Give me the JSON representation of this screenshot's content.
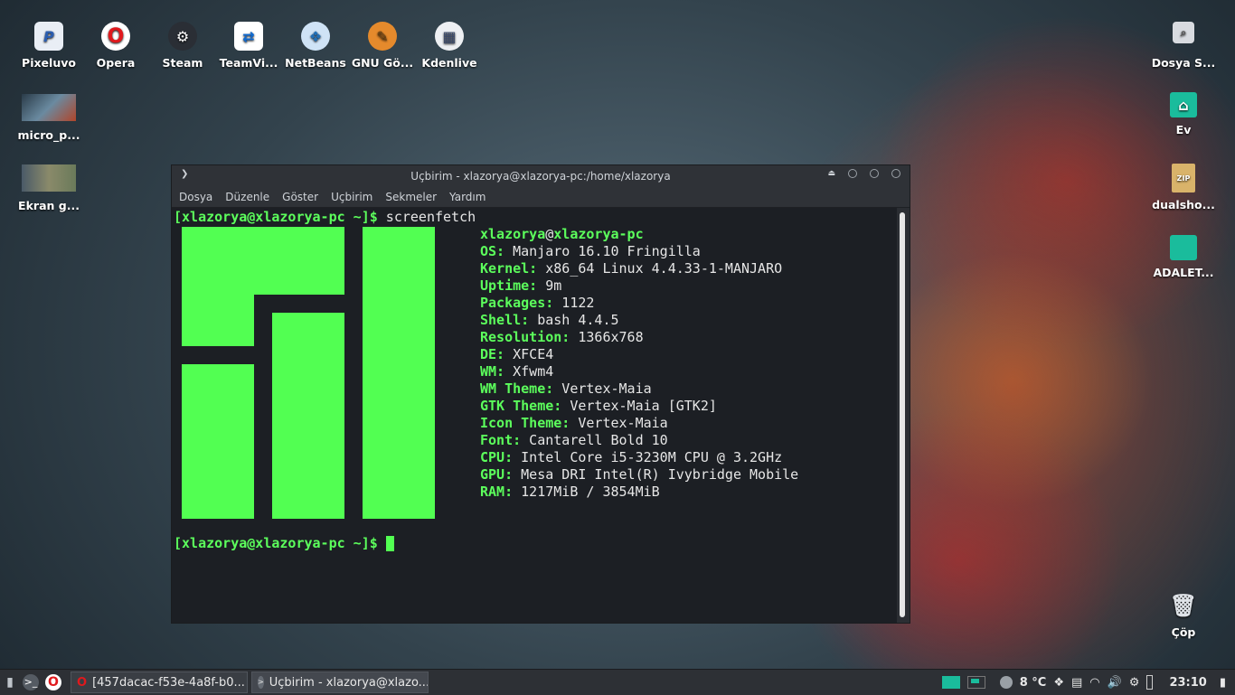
{
  "desktop_left": [
    {
      "label": "Pixeluvo",
      "icon": "pixeluvo-icon"
    },
    {
      "label": "Opera",
      "icon": "opera-icon"
    },
    {
      "label": "Steam",
      "icon": "steam-icon"
    },
    {
      "label": "TeamVi...",
      "icon": "teamviewer-icon"
    },
    {
      "label": "NetBeans",
      "icon": "netbeans-icon"
    },
    {
      "label": "GNU Gö...",
      "icon": "gimp-icon"
    },
    {
      "label": "Kdenlive",
      "icon": "kdenlive-icon"
    },
    {
      "label": "micro_p...",
      "icon": "image-thumbnail-icon"
    },
    {
      "label": "Ekran g...",
      "icon": "screenshot-thumbnail-icon"
    }
  ],
  "desktop_right": [
    {
      "label": "Dosya S...",
      "icon": "file-system-icon"
    },
    {
      "label": "Ev",
      "icon": "home-folder-icon"
    },
    {
      "label": "dualsho...",
      "icon": "zip-archive-icon"
    },
    {
      "label": "ADALET...",
      "icon": "folder-icon"
    },
    {
      "label": "Çöp",
      "icon": "trash-icon"
    }
  ],
  "window": {
    "title": "Uçbirim - xlazorya@xlazorya-pc:/home/xlazorya",
    "menu": [
      "Dosya",
      "Düzenle",
      "Göster",
      "Uçbirim",
      "Sekmeler",
      "Yardım"
    ]
  },
  "terminal": {
    "prompt": "[xlazorya@xlazorya-pc ~]$",
    "command": " screenfetch",
    "user": "xlazorya",
    "at": "@",
    "host": "xlazorya-pc",
    "info": [
      {
        "key": "OS:",
        "value": " Manjaro 16.10 Fringilla"
      },
      {
        "key": "Kernel:",
        "value": " x86_64 Linux 4.4.33-1-MANJARO"
      },
      {
        "key": "Uptime:",
        "value": " 9m"
      },
      {
        "key": "Packages:",
        "value": " 1122"
      },
      {
        "key": "Shell:",
        "value": " bash 4.4.5"
      },
      {
        "key": "Resolution:",
        "value": " 1366x768"
      },
      {
        "key": "DE:",
        "value": " XFCE4"
      },
      {
        "key": "WM:",
        "value": " Xfwm4"
      },
      {
        "key": "WM Theme:",
        "value": " Vertex-Maia"
      },
      {
        "key": "GTK Theme:",
        "value": " Vertex-Maia [GTK2]"
      },
      {
        "key": "Icon Theme:",
        "value": " Vertex-Maia"
      },
      {
        "key": "Font:",
        "value": " Cantarell Bold 10"
      },
      {
        "key": "CPU:",
        "value": " Intel Core i5-3230M CPU @ 3.2GHz"
      },
      {
        "key": "GPU:",
        "value": " Mesa DRI Intel(R) Ivybridge Mobile"
      },
      {
        "key": "RAM:",
        "value": " 1217MiB / 3854MiB"
      }
    ],
    "prompt2": "[xlazorya@xlazorya-pc ~]$"
  },
  "taskbar": {
    "tasks": [
      {
        "label": "[457dacac-f53e-4a8f-b0...",
        "icon": "opera-icon"
      },
      {
        "label": "Uçbirim - xlazorya@xlazo...",
        "icon": "terminal-icon"
      }
    ],
    "weather": "8 °C",
    "clock": "23:10"
  },
  "colors": {
    "terminal_green": "#52ff52",
    "terminal_bg": "#1c1f24",
    "accent": "#1abc9c"
  }
}
